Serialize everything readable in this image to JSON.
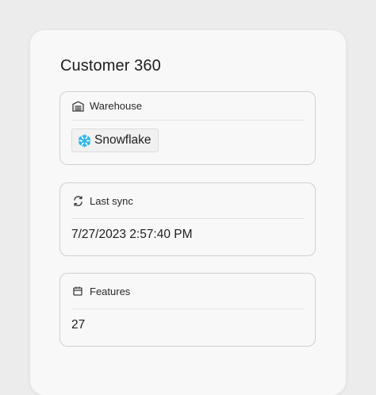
{
  "page": {
    "title": "Customer 360"
  },
  "warehouse": {
    "label": "Warehouse",
    "icon": "warehouse-icon",
    "value": "Snowflake",
    "value_icon": "snowflake-icon",
    "value_icon_color": "#29b5e8"
  },
  "last_sync": {
    "label": "Last sync",
    "icon": "sync-icon",
    "value": "7/27/2023 2:57:40 PM"
  },
  "features": {
    "label": "Features",
    "icon": "calendar-icon",
    "value": "27"
  }
}
